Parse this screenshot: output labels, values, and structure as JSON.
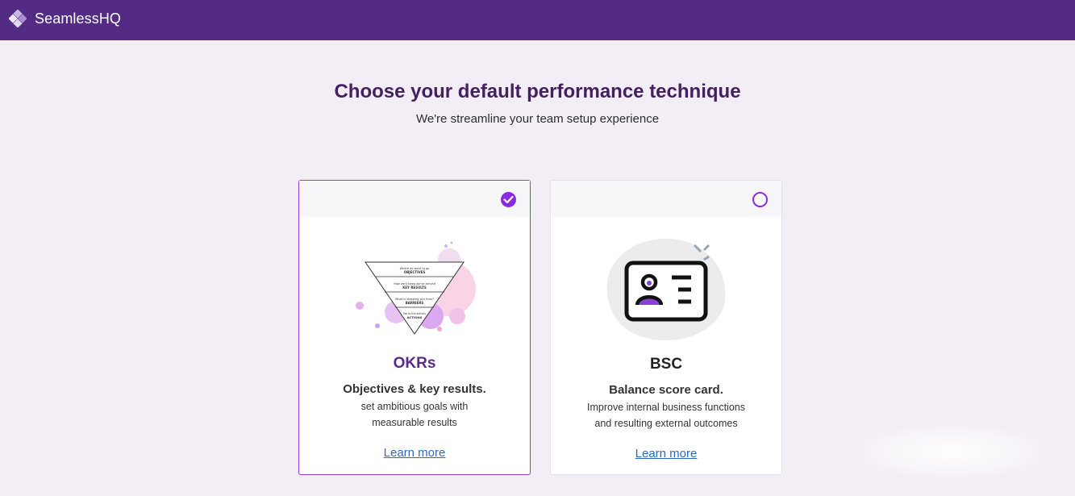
{
  "header": {
    "brand": "SeamlessHQ",
    "logo_icon": "seamless-logo-icon",
    "bg_color": "#532a84"
  },
  "page": {
    "title": "Choose your default performance technique",
    "subtitle": "We're streamline your team setup experience"
  },
  "cards": [
    {
      "id": "okrs",
      "selected": true,
      "title": "OKRs",
      "subtitle": "Objectives & key results.",
      "description_lines": [
        "set ambitious goals with",
        "measurable results"
      ],
      "learn_more": "Learn more",
      "illustration": {
        "icon": "okr-pyramid-illustration",
        "levels": [
          {
            "question": "Where do want to go",
            "label": "OBJECTIVES"
          },
          {
            "question": "How we'll know we've arrived",
            "label": "KEY RESULTS"
          },
          {
            "question": "What is stopping you from?",
            "label": "BARRIERS"
          },
          {
            "question": "Tap to the activity",
            "label": "ACTIONS"
          }
        ]
      }
    },
    {
      "id": "bsc",
      "selected": false,
      "title": "BSC",
      "subtitle": "Balance score card.",
      "description_lines": [
        "Improve internal business functions",
        "and resulting external outcomes"
      ],
      "learn_more": "Learn more",
      "illustration": {
        "icon": "id-card-illustration"
      }
    }
  ],
  "colors": {
    "accent": "#8a2be2",
    "heading": "#43205f",
    "okr_title": "#5a2a8a",
    "link": "#2a6bc2",
    "background": "#f3edf6"
  }
}
